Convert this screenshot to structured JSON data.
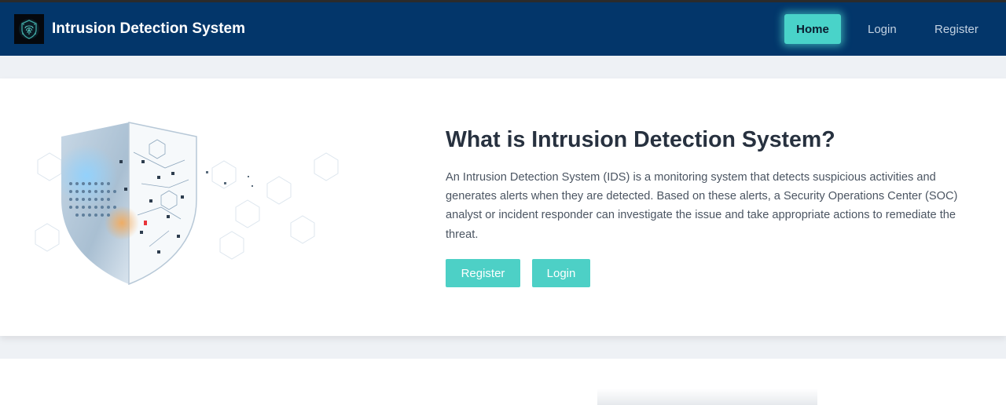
{
  "navbar": {
    "brand_title": "Intrusion Detection System",
    "logo_icon": "fingerprint-shield-icon",
    "items": [
      {
        "label": "Home",
        "active": true
      },
      {
        "label": "Login",
        "active": false
      },
      {
        "label": "Register",
        "active": false
      }
    ]
  },
  "hero": {
    "title": "What is Intrusion Detection System?",
    "description": "An Intrusion Detection System (IDS) is a monitoring system that detects suspicious activities and generates alerts when they are detected. Based on these alerts, a Security Operations Center (SOC) analyst or incident responder can investigate the issue and take appropriate actions to remediate the threat.",
    "register_label": "Register",
    "login_label": "Login",
    "image_icon": "security-shield-illustration"
  },
  "colors": {
    "navbar_bg": "#03366a",
    "accent": "#4dd0c6",
    "page_bg": "#eef1f5",
    "title_text": "#27313f"
  }
}
